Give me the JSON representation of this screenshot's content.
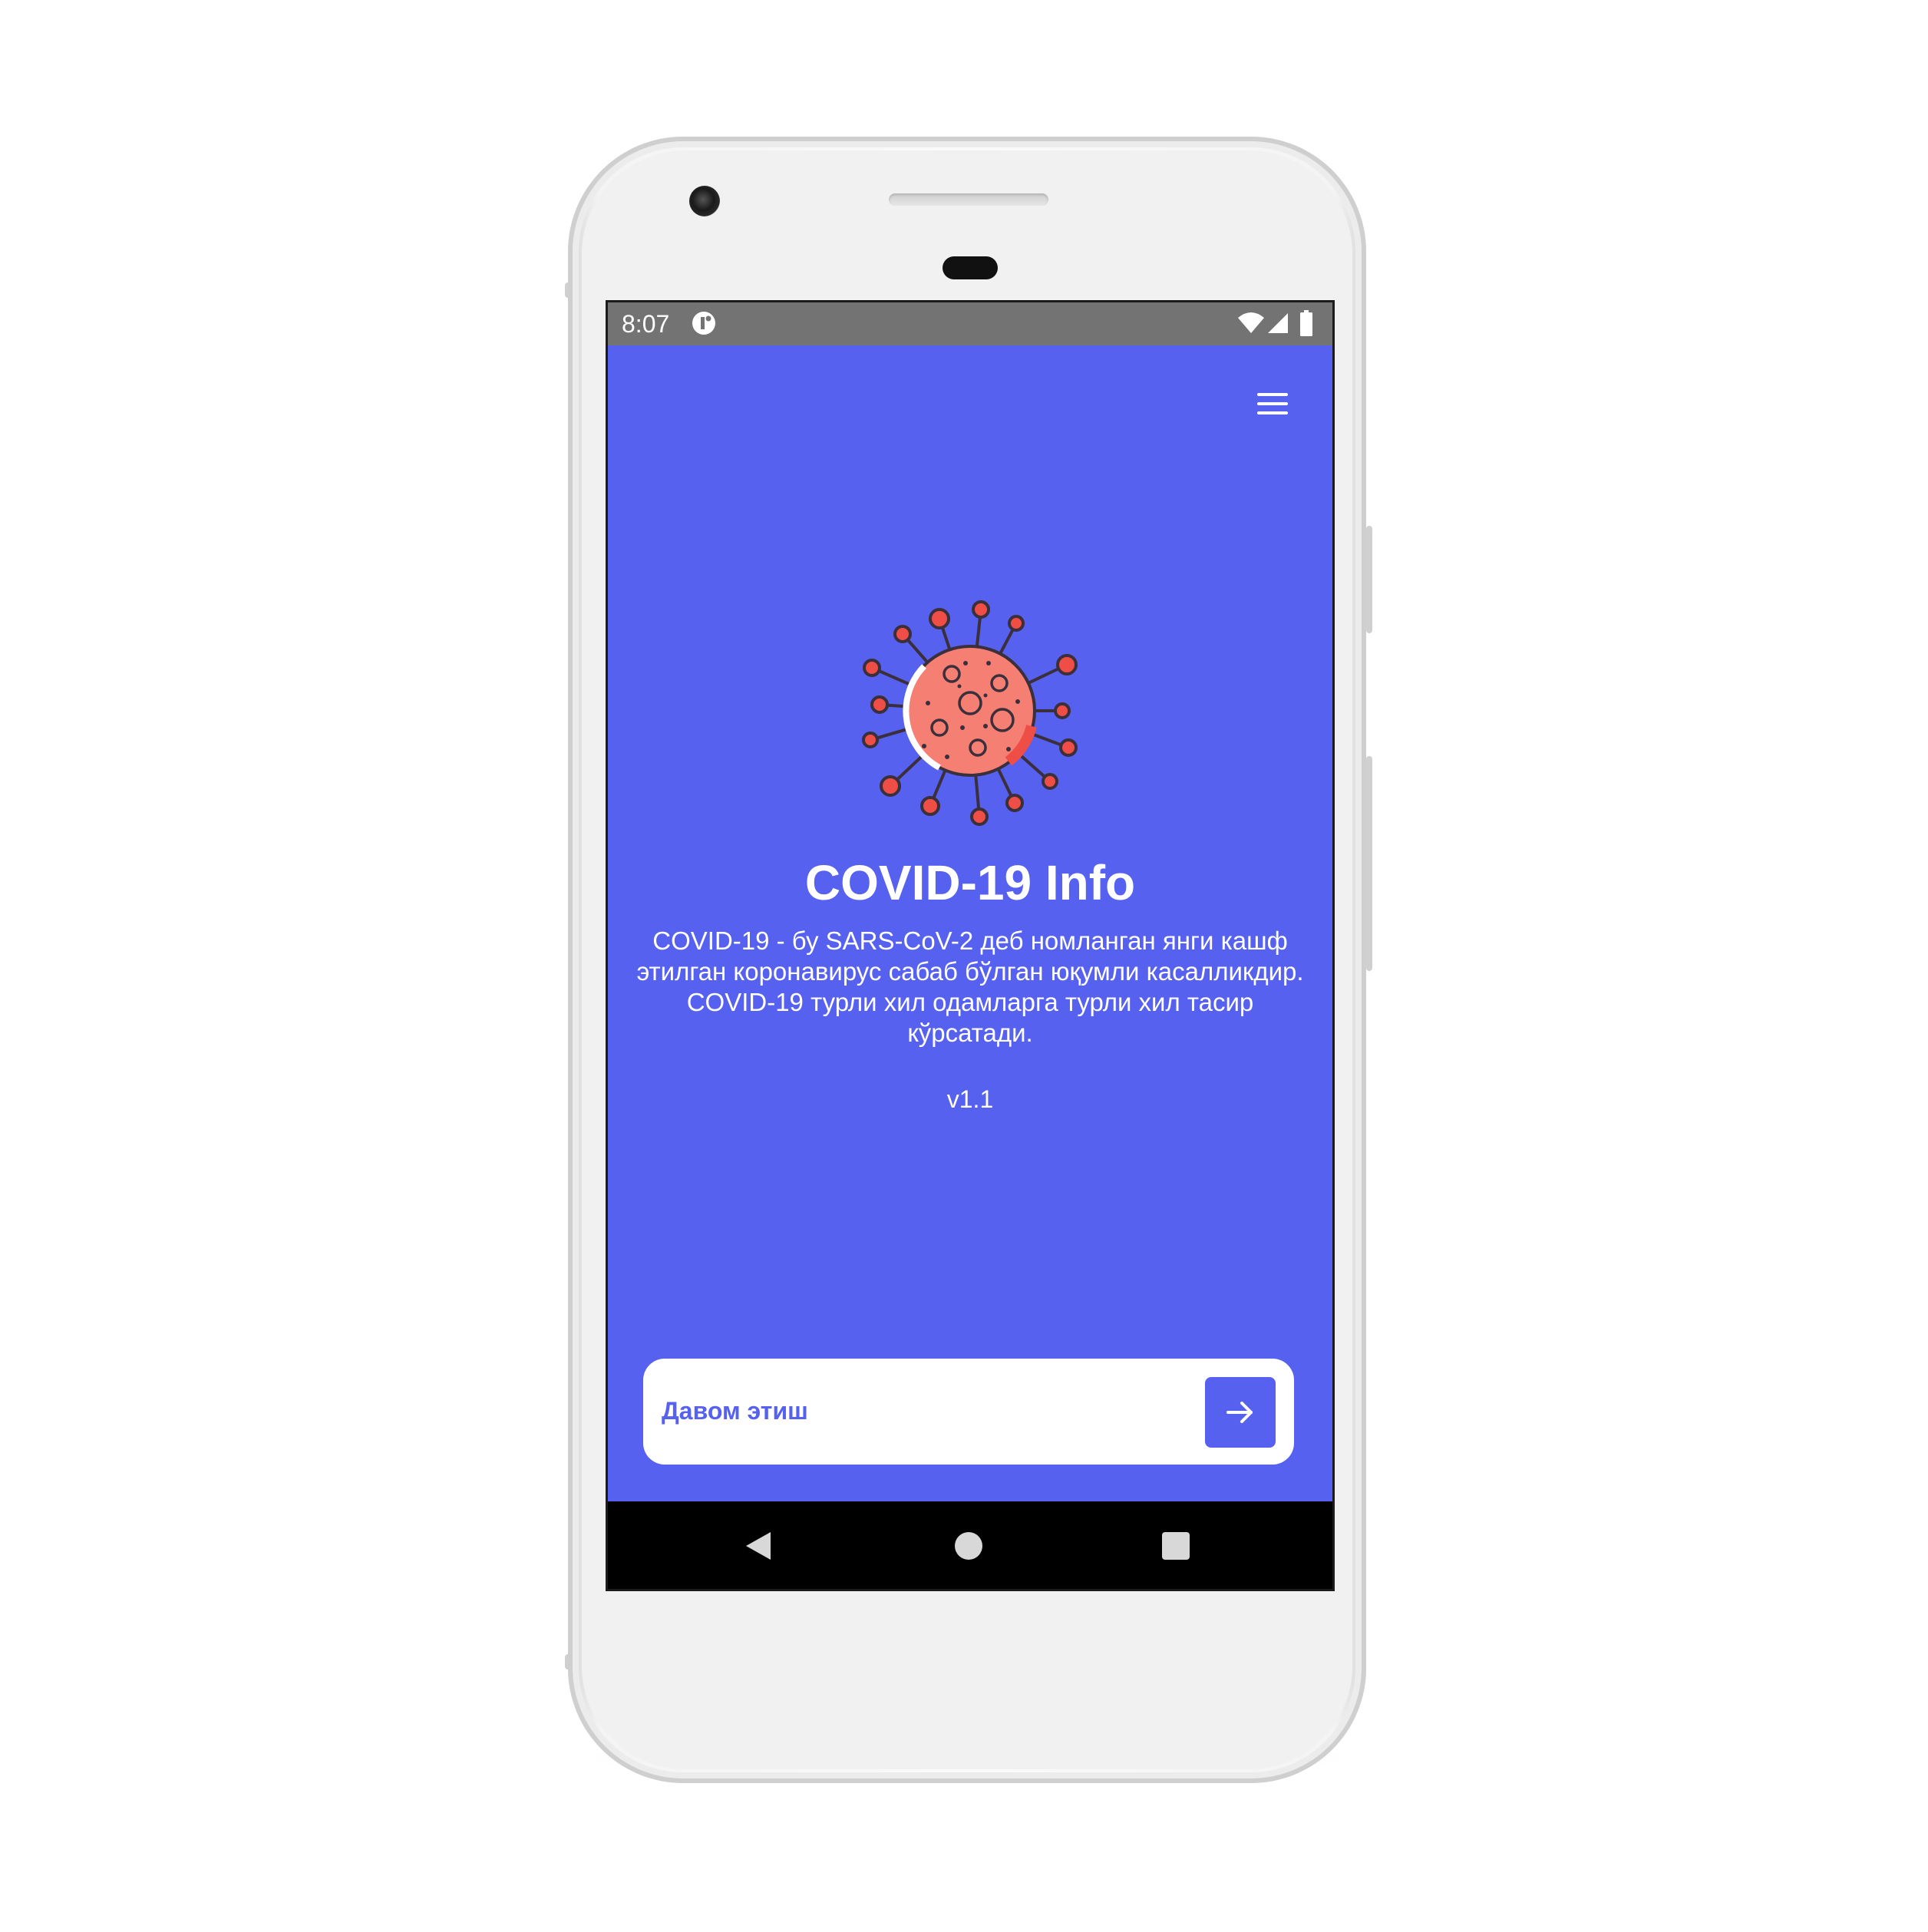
{
  "status_bar": {
    "time": "8:07",
    "icons": [
      "app-notification-icon",
      "wifi-icon",
      "signal-icon",
      "battery-icon"
    ]
  },
  "header": {
    "menu_icon": "hamburger-menu-icon"
  },
  "hero": {
    "illustration": "virus-icon",
    "title": "COVID-19 Info",
    "description": "COVID-19 - бу SARS-CoV-2 деб номланган янги кашф этилган коронавирус сабаб бўлган юқумли касалликдир. COVID-19 турли хил одамларга турли хил тасир кўрсатади.",
    "version": "v1.1"
  },
  "continue": {
    "label": "Давом этиш",
    "icon": "arrow-right-icon"
  },
  "navigation": {
    "icons": [
      "back-icon",
      "home-icon",
      "recents-icon"
    ]
  },
  "colors": {
    "primary": "#5661ef",
    "status_bar": "#737373",
    "nav_bar": "#000000",
    "virus_body": "#f57f73",
    "virus_accent": "#ef4e46",
    "virus_outline": "#3a2f3a"
  }
}
